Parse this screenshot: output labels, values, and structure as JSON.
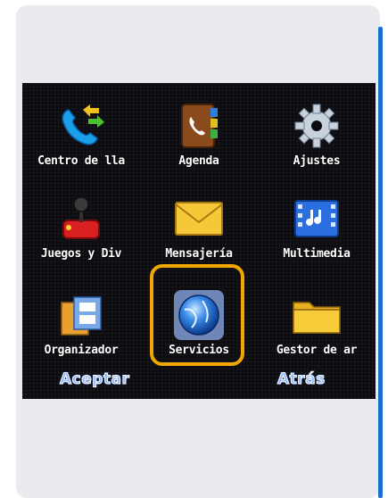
{
  "menu": {
    "items": [
      {
        "label": "Centro de lla",
        "icon": "call-center-icon"
      },
      {
        "label": "Agenda",
        "icon": "phonebook-icon"
      },
      {
        "label": "Ajustes",
        "icon": "gear-icon"
      },
      {
        "label": "Juegos y Div",
        "icon": "joystick-icon"
      },
      {
        "label": "Mensajería",
        "icon": "envelope-icon"
      },
      {
        "label": "Multimedia",
        "icon": "film-music-icon"
      },
      {
        "label": "Organizador",
        "icon": "organizer-icon"
      },
      {
        "label": "Servicios",
        "icon": "globe-icon"
      },
      {
        "label": "Gestor de ar",
        "icon": "folder-icon"
      }
    ],
    "selected": "Servicios"
  },
  "softkeys": {
    "left": "Aceptar",
    "right": "Atrás"
  },
  "colors": {
    "highlight": "#f0a800",
    "card": "#e9ebef",
    "screen": "#0b0b10",
    "softkey": "#8fb8ff"
  }
}
